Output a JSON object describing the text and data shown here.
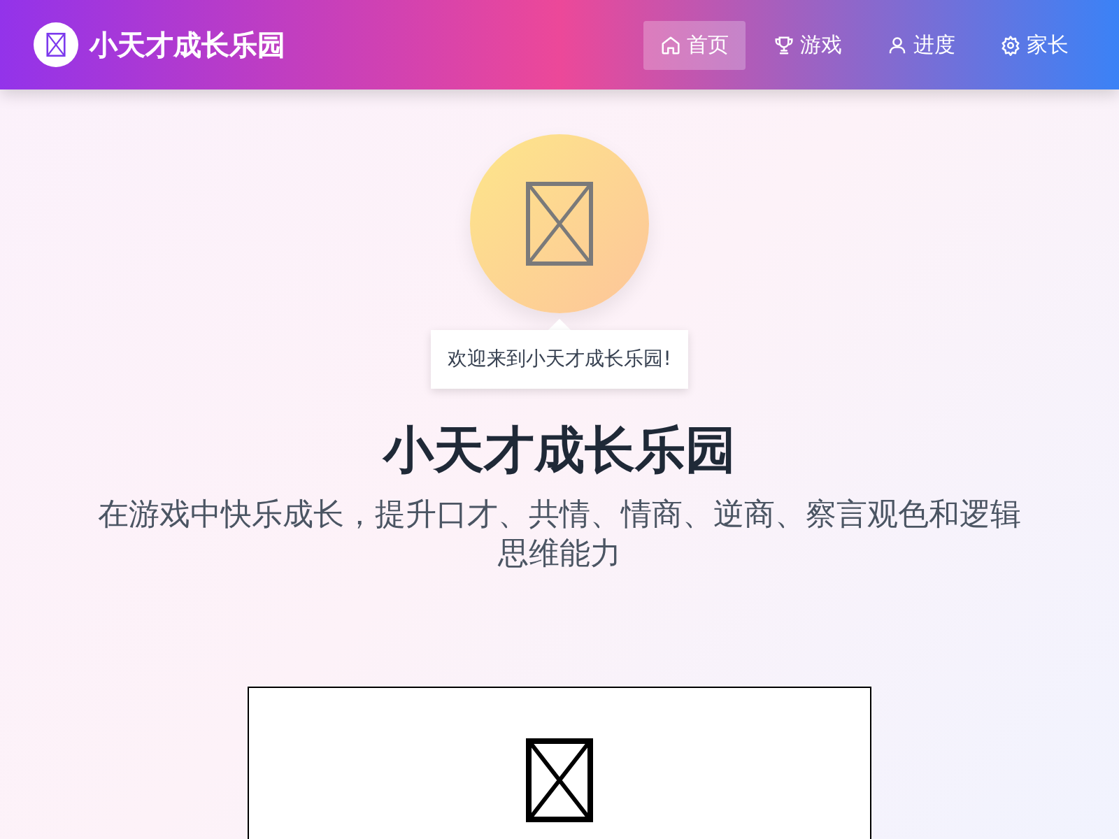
{
  "header": {
    "title": "小天才成长乐园"
  },
  "nav": [
    {
      "label": "首页",
      "selected": true
    },
    {
      "label": "游戏",
      "selected": false
    },
    {
      "label": "进度",
      "selected": false
    },
    {
      "label": "家长",
      "selected": false
    }
  ],
  "hero": {
    "greeting": "欢迎来到小天才成长乐园!",
    "title": "小天才成长乐园",
    "subtitle": "在游戏中快乐成长，提升口才、共情、情商、逆商、察言观色和逻辑思维能力"
  }
}
